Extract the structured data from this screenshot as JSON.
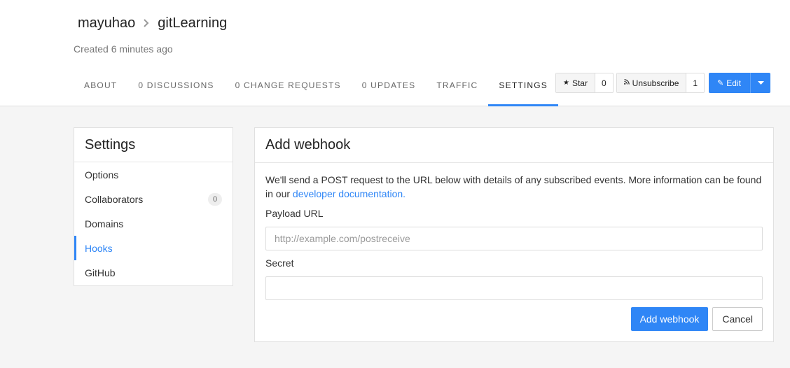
{
  "header": {
    "owner": "mayuhao",
    "repo": "gitLearning",
    "created": "Created 6 minutes ago",
    "tabs": [
      {
        "label": "ABOUT"
      },
      {
        "label": "0 DISCUSSIONS"
      },
      {
        "label": "0 CHANGE REQUESTS"
      },
      {
        "label": "0 UPDATES"
      },
      {
        "label": "TRAFFIC"
      },
      {
        "label": "SETTINGS"
      }
    ],
    "active_tab": "SETTINGS",
    "star": {
      "label": "Star",
      "count": "0",
      "icon": "star-icon"
    },
    "unsubscribe": {
      "label": "Unsubscribe",
      "count": "1",
      "icon": "rss-icon"
    },
    "edit": {
      "label": "Edit",
      "icon": "pencil-icon"
    }
  },
  "sidebar": {
    "title": "Settings",
    "items": [
      {
        "label": "Options"
      },
      {
        "label": "Collaborators",
        "badge": "0"
      },
      {
        "label": "Domains"
      },
      {
        "label": "Hooks"
      },
      {
        "label": "GitHub"
      }
    ],
    "active": "Hooks"
  },
  "panel": {
    "title": "Add webhook",
    "description": "We'll send a POST request to the URL below with details of any subscribed events. More information can be found in our ",
    "link_text": "developer documentation.",
    "payload_label": "Payload URL",
    "payload_placeholder": "http://example.com/postreceive",
    "secret_label": "Secret",
    "secret_value": "",
    "submit_label": "Add webhook",
    "cancel_label": "Cancel"
  },
  "colors": {
    "accent": "#2f86f6"
  }
}
